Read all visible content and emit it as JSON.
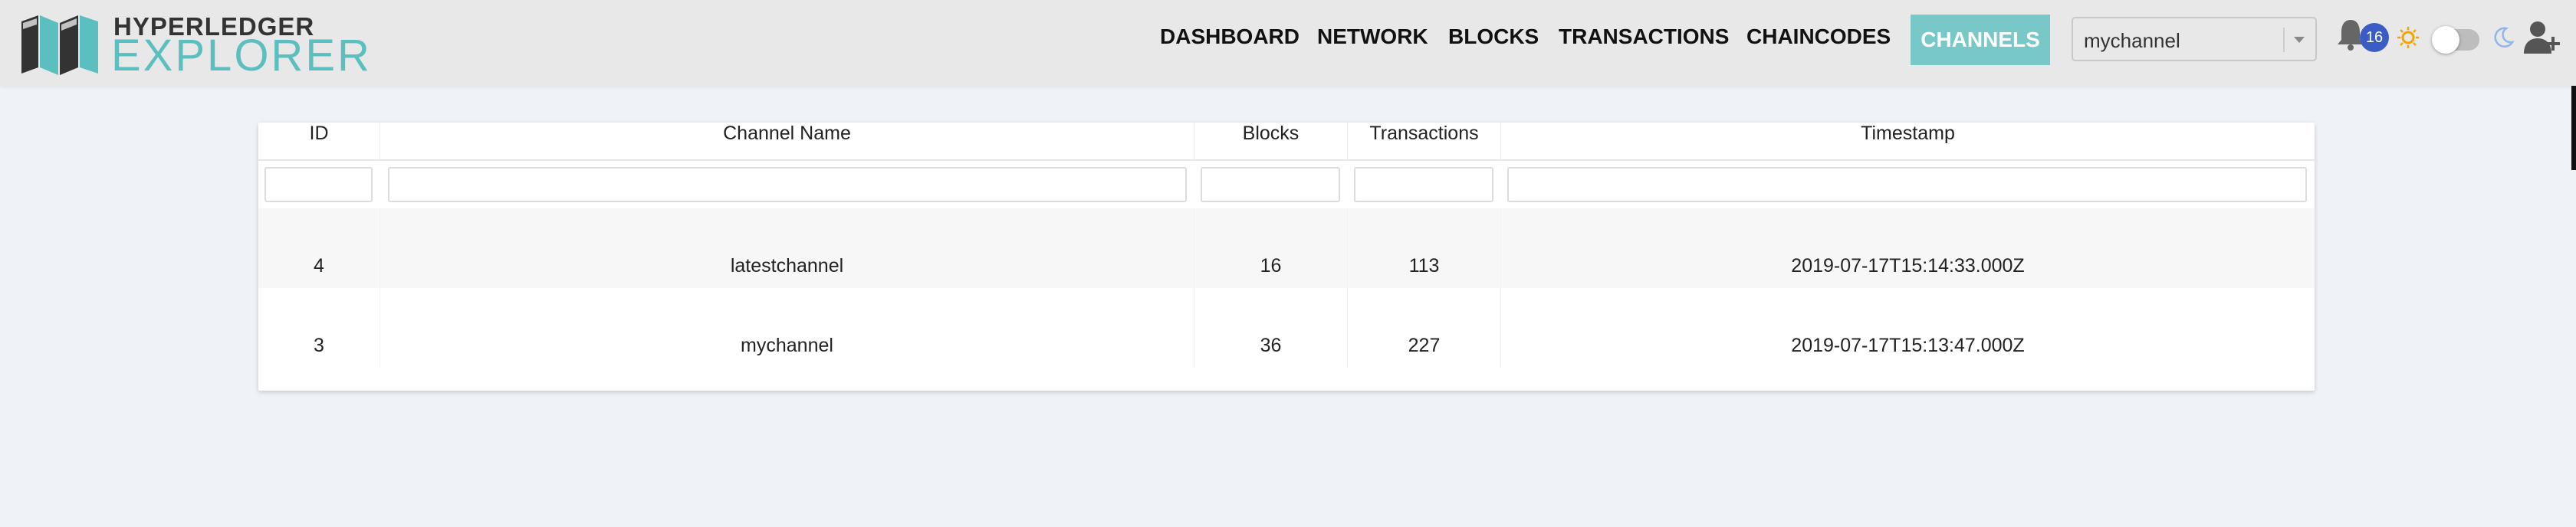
{
  "brand": {
    "top": "HYPERLEDGER",
    "bottom": "EXPLORER"
  },
  "nav": {
    "items": [
      {
        "label": "DASHBOARD"
      },
      {
        "label": "NETWORK"
      },
      {
        "label": "BLOCKS"
      },
      {
        "label": "TRANSACTIONS"
      },
      {
        "label": "CHAINCODES"
      },
      {
        "label": "CHANNELS",
        "active": true
      }
    ],
    "channel_select": {
      "value": "mychannel"
    },
    "notifications": {
      "count": "16",
      "icon": "bell-icon"
    },
    "theme": {
      "light_icon": "sun-icon",
      "dark_icon": "moon-icon",
      "toggle_on": false
    },
    "register_icon": "add-user-icon"
  },
  "table": {
    "columns": [
      "ID",
      "Channel Name",
      "Blocks",
      "Transactions",
      "Timestamp"
    ],
    "filters": [
      "",
      "",
      "",
      "",
      ""
    ],
    "rows": [
      {
        "id": "4",
        "channel_name": "latestchannel",
        "blocks": "16",
        "transactions": "113",
        "timestamp": "2019-07-17T15:14:33.000Z"
      },
      {
        "id": "3",
        "channel_name": "mychannel",
        "blocks": "36",
        "transactions": "227",
        "timestamp": "2019-07-17T15:13:47.000Z"
      }
    ]
  },
  "colors": {
    "accent": "#79c8c8",
    "brand_teal": "#5bbfbf",
    "badge": "#3b5cc4",
    "navbar_bg": "#e8e8e8",
    "page_bg": "#eff2f7"
  }
}
